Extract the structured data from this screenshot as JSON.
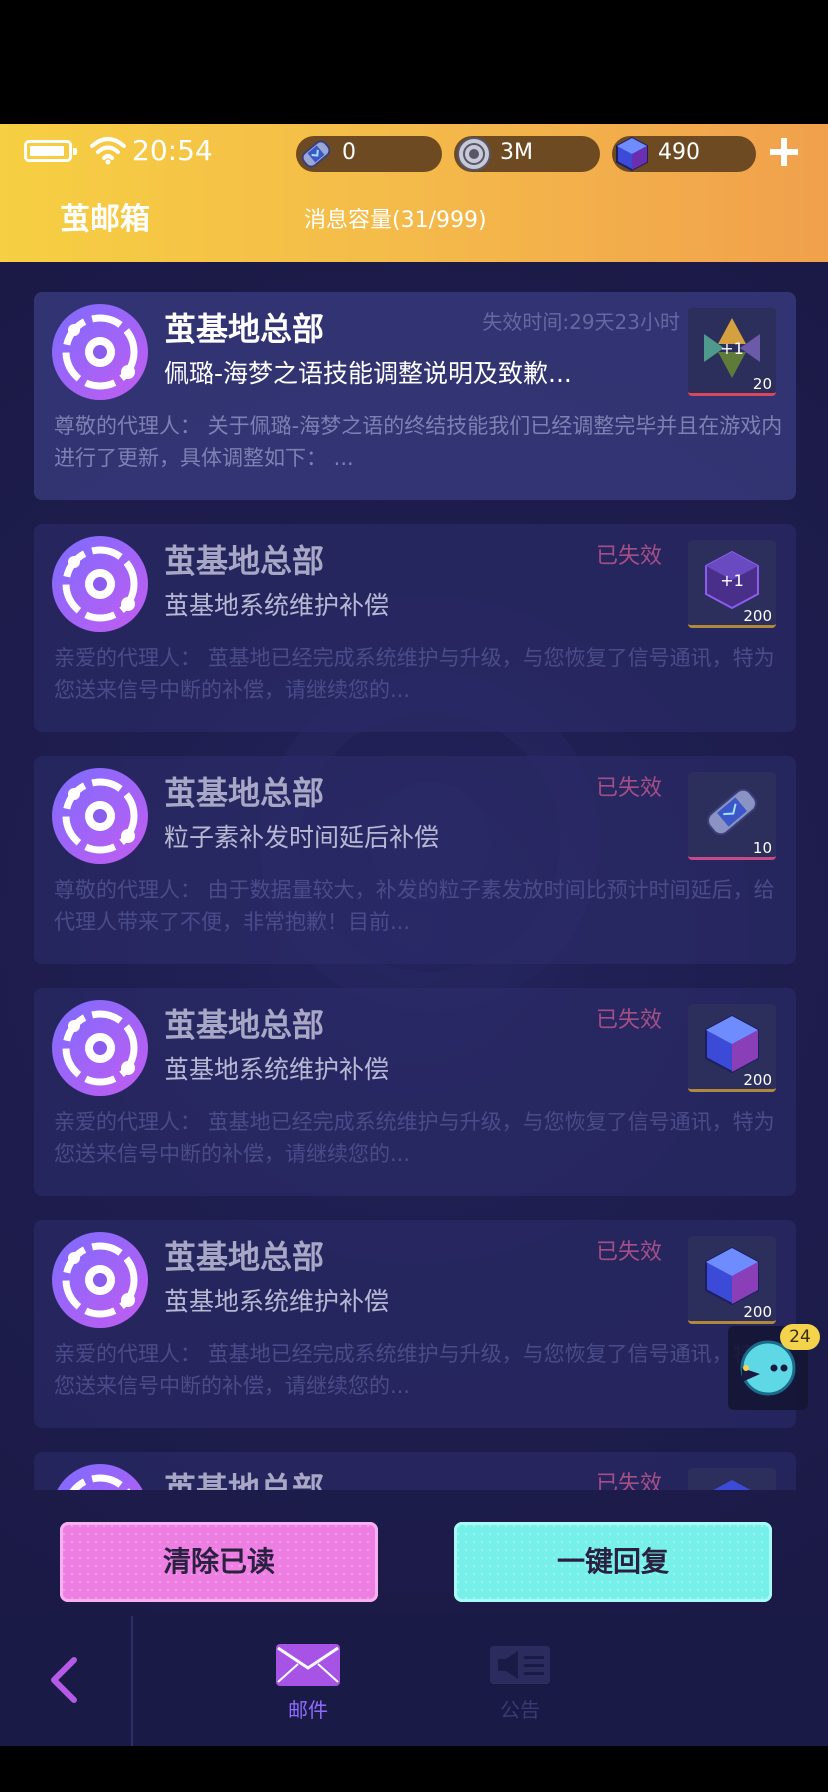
{
  "status_bar": {
    "time": "20:54"
  },
  "currencies": [
    {
      "icon": "particle-capsule-icon",
      "value": "0"
    },
    {
      "icon": "coin-disc-icon",
      "value": "3M"
    },
    {
      "icon": "blue-cube-icon",
      "value": "490"
    }
  ],
  "header": {
    "title": "茧邮箱",
    "capacity": "消息容量(31/999)"
  },
  "mails": [
    {
      "sender": "茧基地总部",
      "subject": "佩璐-海梦之语技能调整说明及致歉...",
      "expiry": "失效时间:29天23小时",
      "status": "",
      "preview": "尊敬的代理人：  关于佩璐-海梦之语的终结技能我们已经调整完毕并且在游戏内进行了更新，具体调整如下：  ...",
      "item_qty": "20",
      "item_icon": "upgrade-crystal-icon"
    },
    {
      "sender": "茧基地总部",
      "subject": "茧基地系统维护补偿",
      "expiry": "",
      "status": "已失效",
      "preview": "亲爱的代理人：  茧基地已经完成系统维护与升级，与您恢复了信号通讯，特为您送来信号中断的补偿，请继续您的...",
      "item_qty": "200",
      "item_icon": "cube-plus-icon"
    },
    {
      "sender": "茧基地总部",
      "subject": "粒子素补发时间延后补偿",
      "expiry": "",
      "status": "已失效",
      "preview": "尊敬的代理人：  由于数据量较大，补发的粒子素发放时间比预计时间延后，给代理人带来了不便，非常抱歉！目前...",
      "item_qty": "10",
      "item_icon": "particle-capsule-icon"
    },
    {
      "sender": "茧基地总部",
      "subject": "茧基地系统维护补偿",
      "expiry": "",
      "status": "已失效",
      "preview": "亲爱的代理人：  茧基地已经完成系统维护与升级，与您恢复了信号通讯，特为您送来信号中断的补偿，请继续您的...",
      "item_qty": "200",
      "item_icon": "blue-cube-icon"
    },
    {
      "sender": "茧基地总部",
      "subject": "茧基地系统维护补偿",
      "expiry": "",
      "status": "已失效",
      "preview": "亲爱的代理人：  茧基地已经完成系统维护与升级，与您恢复了信号通讯，特为您送来信号中断的补偿，请继续您的...",
      "item_qty": "200",
      "item_icon": "blue-cube-icon"
    },
    {
      "sender": "茧基地总部",
      "subject": "",
      "expiry": "",
      "status": "已失效",
      "preview": "",
      "item_qty": "",
      "item_icon": "blue-cube-icon"
    }
  ],
  "floating": {
    "badge": "24"
  },
  "actions": {
    "clear_read": "清除已读",
    "one_click_reply": "一键回复"
  },
  "nav": {
    "mail_label": "邮件",
    "notice_label": "公告"
  },
  "colors": {
    "header_gradient_start": "#f6cf42",
    "header_gradient_end": "#f1a04c",
    "background": "#1e1d4e",
    "expired_status": "#a54f86",
    "clear_button": "#ee7fe2",
    "reply_button": "#77f0ea",
    "active_tab": "#8f6cff"
  }
}
